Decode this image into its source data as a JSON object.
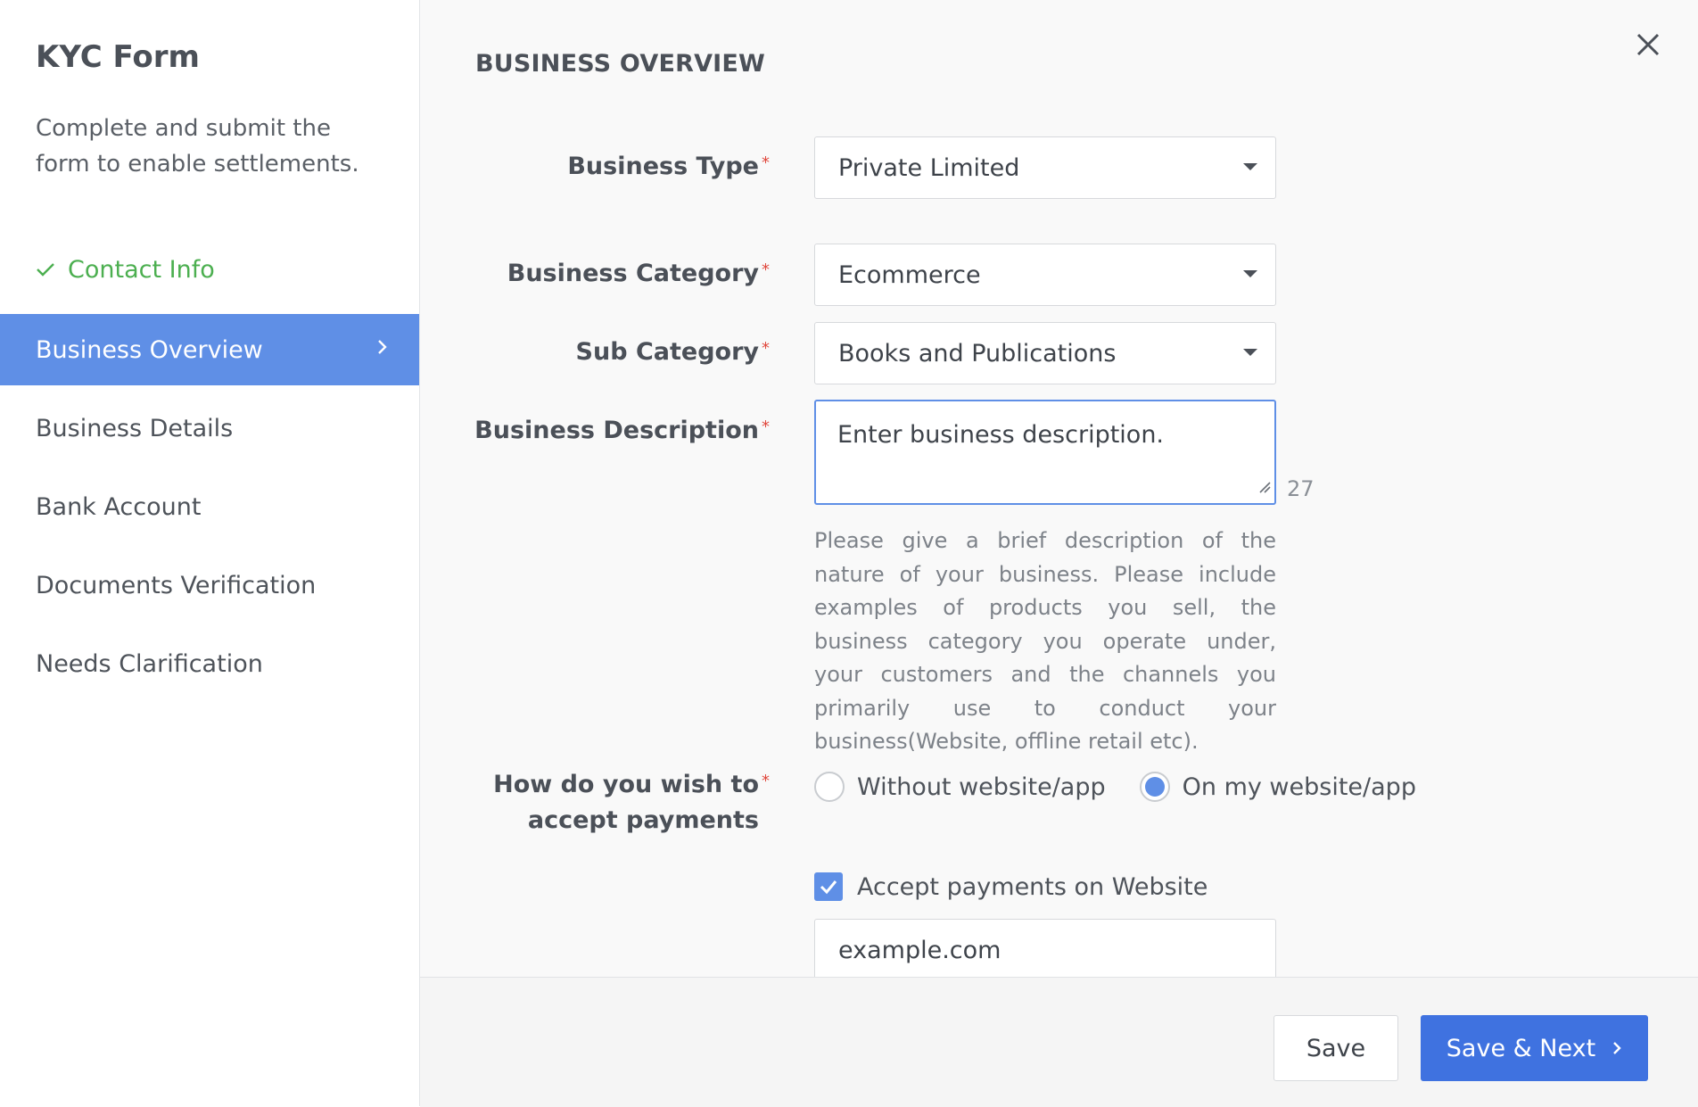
{
  "sidebar": {
    "title": "KYC Form",
    "subtitle": "Complete and submit the form to enable settlements.",
    "items": [
      {
        "label": "Contact Info",
        "state": "completed"
      },
      {
        "label": "Business Overview",
        "state": "active"
      },
      {
        "label": "Business Details",
        "state": "default"
      },
      {
        "label": "Bank Account",
        "state": "default"
      },
      {
        "label": "Documents Verification",
        "state": "default"
      },
      {
        "label": "Needs Clarification",
        "state": "default"
      }
    ]
  },
  "main": {
    "section_title": "BUSINESS OVERVIEW",
    "close_icon": "close-icon",
    "fields": {
      "business_type": {
        "label": "Business Type",
        "value": "Private Limited",
        "required": true
      },
      "business_category": {
        "label": "Business Category",
        "value": "Ecommerce",
        "required": true
      },
      "sub_category": {
        "label": "Sub Category",
        "value": "Books and Publications",
        "required": true
      },
      "business_description": {
        "label": "Business Description",
        "placeholder": "Enter business description.",
        "char_count": "27",
        "help": "Please give a brief description of the nature of your business. Please include examples of products you sell, the business category you operate under, your customers and the channels you primarily use to conduct your business(Website, offline retail etc).",
        "required": true
      },
      "accept_payments": {
        "label": "How do you wish to accept payments",
        "required": true,
        "options": [
          {
            "label": "Without website/app",
            "selected": false
          },
          {
            "label": "On my website/app",
            "selected": true
          }
        ]
      },
      "accept_on_website": {
        "label": "Accept payments on Website",
        "checked": true
      },
      "website_url": {
        "value": "example.com"
      }
    }
  },
  "footer": {
    "save_label": "Save",
    "save_next_label": "Save & Next"
  },
  "colors": {
    "accent": "#5f8fe6",
    "primary_button": "#3f72e0",
    "success": "#4caf50",
    "required": "#e0483d"
  }
}
